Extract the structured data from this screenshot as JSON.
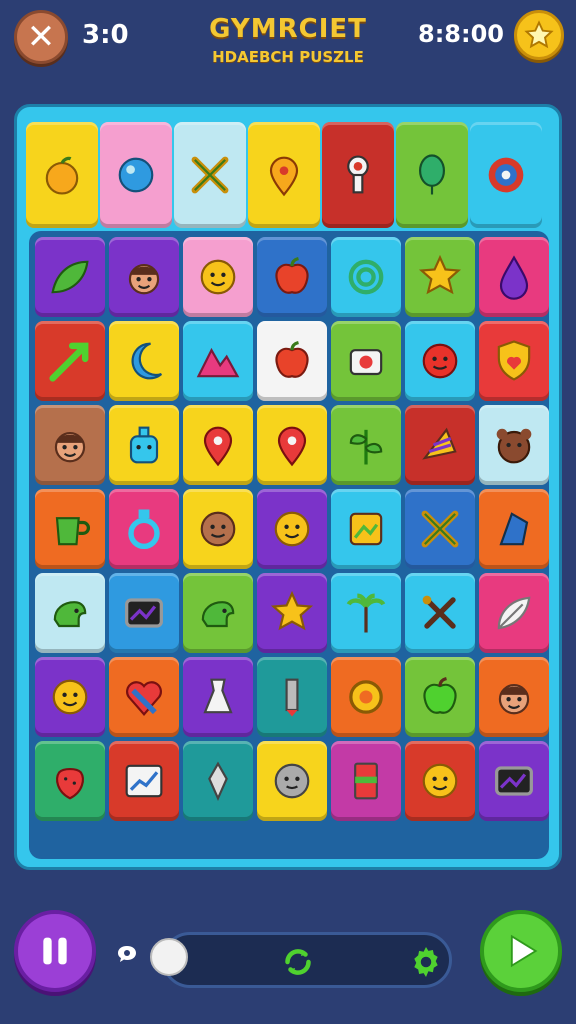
{
  "header": {
    "score_left": "3:0",
    "title": "GYMRCIET",
    "subtitle": "HDAEBCH PUSZLE",
    "timer_right": "8:8:00"
  },
  "controls": {
    "pause_icon": "pause-icon",
    "play_icon": "play-icon",
    "refresh_icon": "refresh-icon",
    "settings_icon": "gear-icon",
    "chat_icon": "speech-bubble-icon"
  },
  "board": {
    "top_row": [
      {
        "icon": "orange-fruit",
        "bg": "#f7d41c"
      },
      {
        "icon": "blue-ball",
        "bg": "#f59fcf"
      },
      {
        "icon": "crossed-sticks",
        "bg": "#bfe8f2"
      },
      {
        "icon": "pin",
        "bg": "#f7d41c"
      },
      {
        "icon": "key",
        "bg": "#c7302a"
      },
      {
        "icon": "balloon",
        "bg": "#74c43a"
      },
      {
        "icon": "sun-gear",
        "bg": "#35c6ec"
      }
    ],
    "rows": [
      [
        {
          "icon": "leaf",
          "bg": "#7b33c9"
        },
        {
          "icon": "face",
          "bg": "#7b33c9"
        },
        {
          "icon": "sun-face",
          "bg": "#f59fcf"
        },
        {
          "icon": "apple",
          "bg": "#2f72c9"
        },
        {
          "icon": "spiral",
          "bg": "#35c6ec"
        },
        {
          "icon": "star-face",
          "bg": "#74c43a"
        },
        {
          "icon": "drop",
          "bg": "#e83a7f"
        }
      ],
      [
        {
          "icon": "arrow-leaf",
          "bg": "#d83a2a"
        },
        {
          "icon": "moon",
          "bg": "#f7d41c"
        },
        {
          "icon": "mountain",
          "bg": "#35c6ec"
        },
        {
          "icon": "apple",
          "bg": "#f4f4f4"
        },
        {
          "icon": "camera",
          "bg": "#74c43a"
        },
        {
          "icon": "red-face",
          "bg": "#35c6ec"
        },
        {
          "icon": "shield",
          "bg": "#e83a3a"
        }
      ],
      [
        {
          "icon": "boy-face",
          "bg": "#b5704c"
        },
        {
          "icon": "robot",
          "bg": "#f7d41c"
        },
        {
          "icon": "heart-pin",
          "bg": "#f7d41c"
        },
        {
          "icon": "heart-pin",
          "bg": "#f7d41c"
        },
        {
          "icon": "plant",
          "bg": "#74c43a"
        },
        {
          "icon": "cone",
          "bg": "#c7302a"
        },
        {
          "icon": "bear",
          "bg": "#bfe8f2"
        }
      ],
      [
        {
          "icon": "cup",
          "bg": "#ef6b22"
        },
        {
          "icon": "ring",
          "bg": "#e83a7f"
        },
        {
          "icon": "cookie",
          "bg": "#f7d41c"
        },
        {
          "icon": "smile",
          "bg": "#7b33c9"
        },
        {
          "icon": "frame",
          "bg": "#35c6ec"
        },
        {
          "icon": "crossed-sticks",
          "bg": "#2f72c9"
        },
        {
          "icon": "crystal",
          "bg": "#ef6b22"
        }
      ],
      [
        {
          "icon": "dino",
          "bg": "#bfe8f2"
        },
        {
          "icon": "tv",
          "bg": "#2f9ae0"
        },
        {
          "icon": "dino",
          "bg": "#74c43a"
        },
        {
          "icon": "star",
          "bg": "#7b33c9"
        },
        {
          "icon": "palm",
          "bg": "#35c6ec"
        },
        {
          "icon": "tools",
          "bg": "#35c6ec"
        },
        {
          "icon": "feather",
          "bg": "#e83a7f"
        }
      ],
      [
        {
          "icon": "smile",
          "bg": "#7b33c9"
        },
        {
          "icon": "heart",
          "bg": "#ef6b22"
        },
        {
          "icon": "dress",
          "bg": "#7b33c9"
        },
        {
          "icon": "pencil",
          "bg": "#1f9a9a"
        },
        {
          "icon": "donut",
          "bg": "#ef6b22"
        },
        {
          "icon": "apple-green",
          "bg": "#74c43a"
        },
        {
          "icon": "boy-face",
          "bg": "#ef6b22"
        }
      ],
      [
        {
          "icon": "strawberry",
          "bg": "#2fae6a"
        },
        {
          "icon": "chart",
          "bg": "#d83a2a"
        },
        {
          "icon": "gem",
          "bg": "#1f9a9a"
        },
        {
          "icon": "gray-face",
          "bg": "#f7d41c"
        },
        {
          "icon": "book",
          "bg": "#c33aa6"
        },
        {
          "icon": "smile",
          "bg": "#d83a2a"
        },
        {
          "icon": "tv",
          "bg": "#7b33c9"
        }
      ]
    ]
  },
  "slider": {
    "level": 0.0
  }
}
